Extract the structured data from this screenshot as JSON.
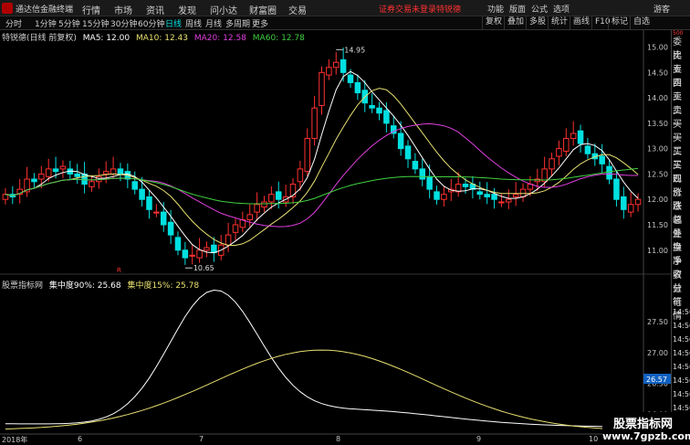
{
  "app": {
    "title": "通达信金融终端",
    "menu": [
      "行情",
      "市场",
      "资讯",
      "发现",
      "问小达",
      "财富圈",
      "交易"
    ],
    "notice": "证券交易未登录",
    "stock_tag": "特锐德",
    "right_menu": [
      "功能",
      "版面",
      "公式",
      "选项"
    ],
    "user": "游客"
  },
  "toolbar": {
    "periods": [
      "分时",
      "1分钟",
      "5分钟",
      "15分钟",
      "30分钟",
      "60分钟",
      "日线",
      "周线",
      "月线",
      "多周期",
      "更多"
    ],
    "active_period": "日线",
    "buttons": [
      "复权",
      "叠加",
      "多股",
      "统计",
      "画线",
      "F10",
      "标记",
      "自选"
    ]
  },
  "main_chart": {
    "title": "特锐德(日线 前复权)",
    "ma": [
      {
        "label": "MA5: 12.00",
        "color": "#ffffff"
      },
      {
        "label": "MA10: 12.43",
        "color": "#e8e070"
      },
      {
        "label": "MA20: 12.58",
        "color": "#e040e0"
      },
      {
        "label": "MA60: 12.78",
        "color": "#40d040"
      }
    ],
    "high_label": "14.95",
    "low_label": "10.65",
    "marker": "R",
    "y_ticks": [
      "15.00",
      "14.50",
      "14.00",
      "13.50",
      "13.00",
      "12.50",
      "12.00",
      "11.50",
      "11.00"
    ]
  },
  "sub_chart": {
    "title": "股票指标网",
    "l1": "集中度90%: 25.68",
    "l2": "集中度15%: 25.78",
    "y_ticks": [
      "27.50",
      "27.00",
      "26.50",
      "26.00"
    ],
    "current_value": "26.57"
  },
  "sidebar": [
    "委比",
    "卖五",
    "卖四",
    "卖三",
    "卖二",
    "卖一",
    "买一",
    "买二",
    "买三",
    "买四",
    "现价",
    "涨跌",
    "涨幅",
    "总量",
    "外盘",
    "换手",
    "净资",
    "收益",
    "分笔",
    "行情",
    "14:56",
    "14:56",
    "14:56",
    "14:56",
    "14:56",
    "14:56",
    "14:56",
    "14:56",
    "14:56"
  ],
  "sidebar_top_tag": "500",
  "dates": [
    "2018年",
    "6",
    "7",
    "8",
    "9",
    "10"
  ],
  "watermark": {
    "big": "股票指标网",
    "small": "www.7gpzb.com"
  },
  "colors": {
    "up": "#ff3030",
    "down": "#00e0e0",
    "ma5": "#ffffff",
    "ma10": "#e8e070",
    "ma20": "#e040e0",
    "ma60": "#40d040",
    "conc90": "#ffffff",
    "conc15": "#e8e070"
  },
  "chart_data": {
    "type": "candlestick",
    "ohlc_close": [
      12.1,
      12.05,
      12.2,
      12.4,
      12.35,
      12.5,
      12.6,
      12.55,
      12.65,
      12.5,
      12.45,
      12.3,
      12.35,
      12.45,
      12.55,
      12.6,
      12.5,
      12.4,
      12.2,
      12.0,
      11.8,
      11.75,
      11.5,
      11.3,
      11.0,
      10.85,
      10.9,
      11.0,
      11.05,
      10.95,
      11.1,
      11.3,
      11.5,
      11.6,
      11.7,
      11.9,
      11.95,
      12.1,
      12.0,
      12.05,
      12.3,
      12.6,
      13.2,
      13.8,
      14.5,
      14.6,
      14.7,
      14.5,
      14.3,
      14.1,
      13.9,
      13.8,
      13.7,
      13.5,
      13.3,
      13.0,
      12.8,
      12.6,
      12.4,
      12.2,
      12.0,
      12.1,
      12.2,
      12.3,
      12.25,
      12.2,
      12.1,
      12.05,
      12.0,
      11.95,
      12.0,
      12.1,
      12.2,
      12.3,
      12.4,
      12.6,
      12.8,
      13.0,
      13.2,
      13.3,
      13.1,
      12.9,
      12.8,
      12.7,
      12.4,
      12.0,
      11.8,
      11.9,
      12.0
    ],
    "y_range": [
      10.6,
      15.1
    ],
    "high": 14.95,
    "low": 10.65,
    "indicator_y_range": [
      25.7,
      28.0
    ]
  }
}
